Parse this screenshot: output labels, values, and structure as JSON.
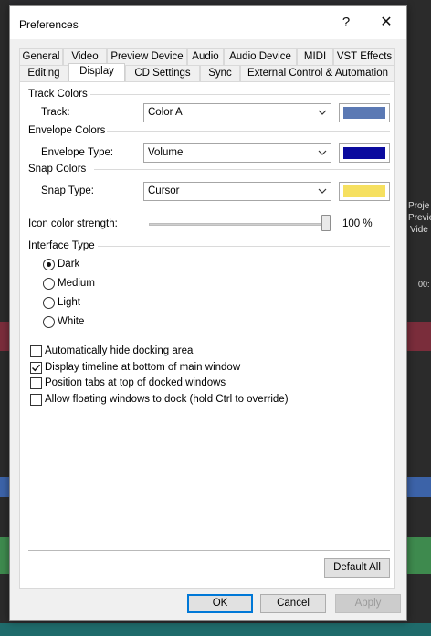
{
  "dialog": {
    "title": "Preferences",
    "help_glyph": "?",
    "close_glyph": "✕"
  },
  "tabs_row1": [
    "General",
    "Video",
    "Preview Device",
    "Audio",
    "Audio Device",
    "MIDI",
    "VST Effects"
  ],
  "tabs_row2": [
    "Editing",
    "Display",
    "CD Settings",
    "Sync",
    "External Control & Automation"
  ],
  "active_tab": "Display",
  "track_colors": {
    "group": "Track Colors",
    "label": "Track:",
    "value": "Color A",
    "color": "#5b79b4"
  },
  "envelope_colors": {
    "group": "Envelope Colors",
    "label": "Envelope Type:",
    "value": "Volume",
    "color": "#0a0a9e"
  },
  "snap_colors": {
    "group": "Snap Colors",
    "label": "Snap Type:",
    "value": "Cursor",
    "color": "#f6e060"
  },
  "icon_strength": {
    "label": "Icon color strength:",
    "value_text": "100 %",
    "value": 100
  },
  "interface_type": {
    "group": "Interface Type",
    "options": [
      "Dark",
      "Medium",
      "Light",
      "White"
    ],
    "selected": "Dark"
  },
  "checkboxes": [
    {
      "label": "Automatically hide docking area",
      "checked": false
    },
    {
      "label": "Display timeline at bottom of main window",
      "checked": true
    },
    {
      "label": "Position tabs at top of docked windows",
      "checked": false
    },
    {
      "label": "Allow floating windows to dock (hold Ctrl to override)",
      "checked": false
    }
  ],
  "buttons": {
    "default_all": "Default All",
    "ok": "OK",
    "cancel": "Cancel",
    "apply": "Apply"
  },
  "background_text": [
    "Proje",
    "Previe",
    "Vide",
    "00:"
  ],
  "colors": {
    "accent": "#0078d7",
    "app_band": "#7a2d3b",
    "app_blue": "#3c63a8",
    "app_green": "#3e8a4e"
  }
}
